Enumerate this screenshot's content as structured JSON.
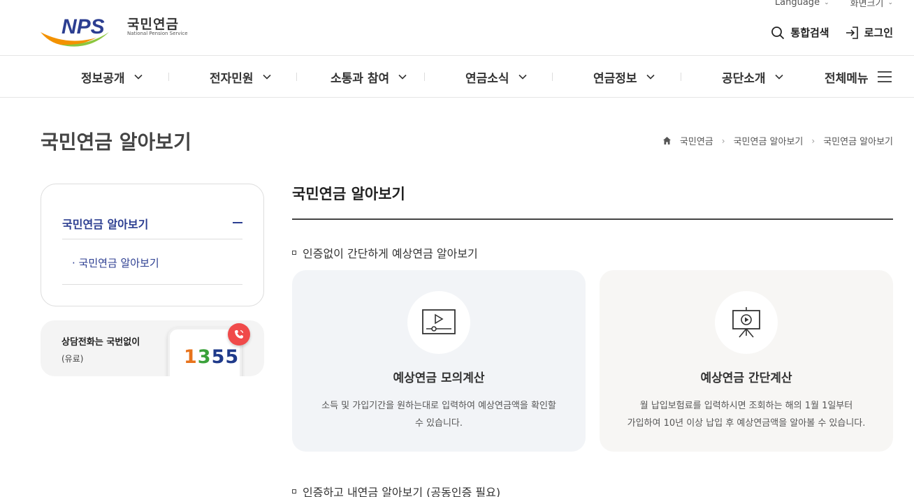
{
  "header": {
    "logo_text": "NPS",
    "logo_ko": "국민연금",
    "logo_en": "National Pension Service",
    "language_label": "Language",
    "screen_size_label": "화면크기",
    "search_label": "통합검색",
    "login_label": "로그인"
  },
  "gnb": {
    "items": [
      {
        "label": "정보공개"
      },
      {
        "label": "전자민원"
      },
      {
        "label": "소통과 참여"
      },
      {
        "label": "연금소식"
      },
      {
        "label": "연금정보"
      },
      {
        "label": "공단소개"
      }
    ],
    "all_menu_label": "전체메뉴"
  },
  "page": {
    "title": "국민연금 알아보기",
    "breadcrumb": [
      "국민연금",
      "국민연금 알아보기",
      "국민연금 알아보기"
    ]
  },
  "sidebar": {
    "title": "국민연금 알아보기",
    "sub_item": "· 국민연금 알아보기",
    "call": {
      "title": "상담전화는 국번없이",
      "subtitle": "(유료)",
      "number_digits": [
        "1",
        "3",
        "5",
        "5"
      ],
      "digit_colors": [
        "#e8731c",
        "#3aa13a",
        "#1f3a8a",
        "#1f3a8a"
      ]
    }
  },
  "main": {
    "title": "국민연금 알아보기",
    "section1": "인증없이 간단하게 예상연금 알아보기",
    "cards": [
      {
        "title": "예상연금 모의계산",
        "desc_lines": [
          "소득 및 가입기간을 원하는대로 입력하여 예상연금액을 확인할",
          "수 있습니다."
        ],
        "icon": "video-player-icon"
      },
      {
        "title": "예상연금 간단계산",
        "desc_lines": [
          "월 납입보험료를 입력하시면 조회하는 해의 1월 1일부터",
          "가입하여 10년 이상 납입 후 예상연금액을 알아볼 수 있습니다."
        ],
        "icon": "presentation-screen-icon"
      }
    ],
    "section2": "인증하고 내연금 알아보기 (공동인증 필요)"
  },
  "colors": {
    "brand_navy": "#2c3e91",
    "logo_orange": "#f39200",
    "logo_green": "#8cc63f",
    "call_badge": "#f04a4a"
  }
}
